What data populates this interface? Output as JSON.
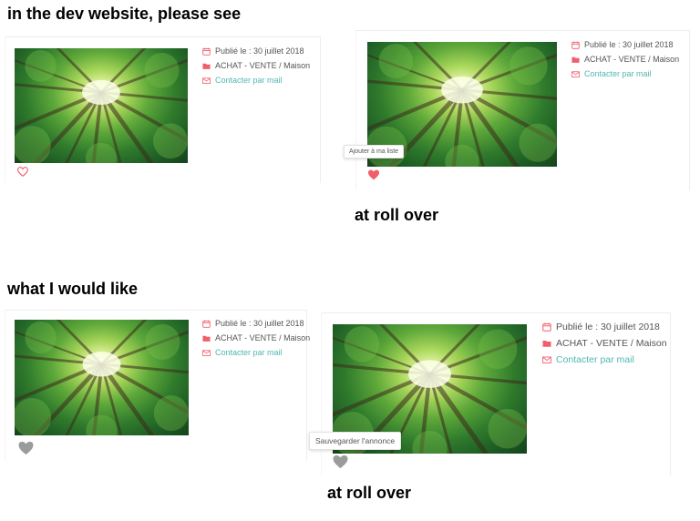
{
  "headings": {
    "current": "in the dev website, please see",
    "desired": "what I would like"
  },
  "captions": {
    "top_rollover": "at roll over",
    "bottom_rollover": "at roll over"
  },
  "listing": {
    "published": "Publié le : 30 juillet 2018",
    "category": "ACHAT - VENTE / Maison",
    "contact": "Contacter par mail"
  },
  "tooltips": {
    "current": "Ajouter à ma liste",
    "desired": "Sauvegarder l'annonce"
  },
  "colors": {
    "accent_red": "#f25d6b",
    "link_teal": "#4fb8b0",
    "heart_grey": "#9b9b9b"
  },
  "icons": [
    "calendar-icon",
    "folder-icon",
    "envelope-icon",
    "heart-outline-icon",
    "heart-filled-icon"
  ]
}
